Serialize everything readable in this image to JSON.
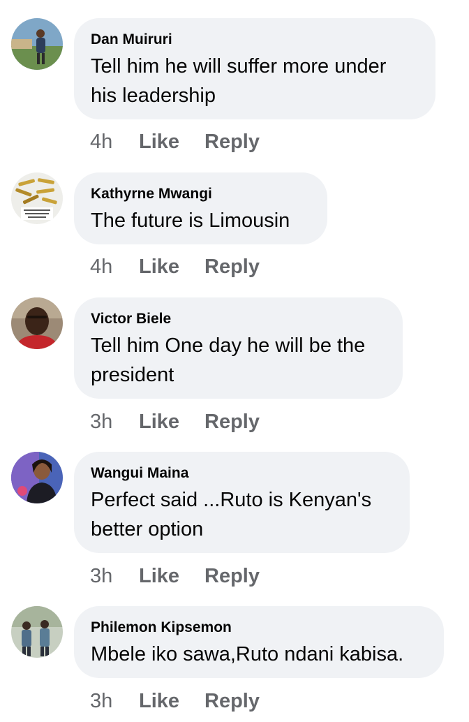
{
  "comments": [
    {
      "author": "Dan Muiruri",
      "text": "Tell him he will suffer more under his leadership",
      "time": "4h",
      "like_label": "Like",
      "reply_label": "Reply"
    },
    {
      "author": "Kathyrne Mwangi",
      "text": "The future is Limousin",
      "time": "4h",
      "like_label": "Like",
      "reply_label": "Reply",
      "avatar_lettering": "may this bullets kill your ENEMIES In Jesus name"
    },
    {
      "author": "Victor Biele",
      "text": "Tell him One day he will be the president",
      "time": "3h",
      "like_label": "Like",
      "reply_label": "Reply"
    },
    {
      "author": "Wangui Maina",
      "text": "Perfect said ...Ruto is Kenyan's better option",
      "time": "3h",
      "like_label": "Like",
      "reply_label": "Reply"
    },
    {
      "author": "Philemon Kipsemon",
      "text": "Mbele iko sawa,Ruto ndani kabisa.",
      "time": "3h",
      "like_label": "Like",
      "reply_label": "Reply"
    }
  ],
  "colors": {
    "bubble_background": "#f0f2f5",
    "text": "#050505",
    "secondary_text": "#65676b"
  }
}
